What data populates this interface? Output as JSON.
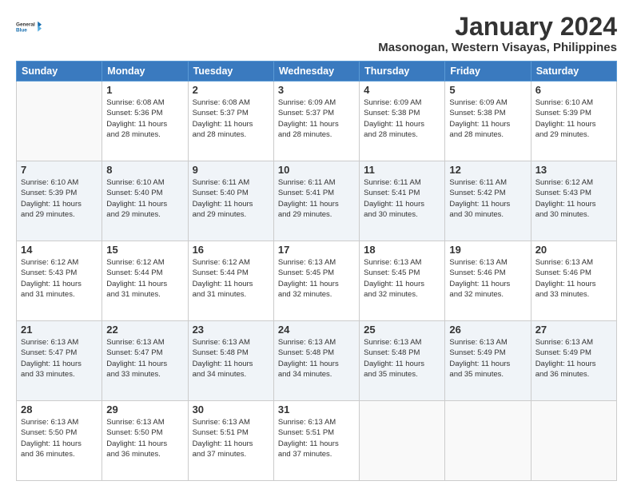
{
  "header": {
    "logo_line1": "General",
    "logo_line2": "Blue",
    "title": "January 2024",
    "subtitle": "Masonogan, Western Visayas, Philippines"
  },
  "days_of_week": [
    "Sunday",
    "Monday",
    "Tuesday",
    "Wednesday",
    "Thursday",
    "Friday",
    "Saturday"
  ],
  "weeks": [
    [
      {
        "day": "",
        "info": ""
      },
      {
        "day": "1",
        "info": "Sunrise: 6:08 AM\nSunset: 5:36 PM\nDaylight: 11 hours\nand 28 minutes."
      },
      {
        "day": "2",
        "info": "Sunrise: 6:08 AM\nSunset: 5:37 PM\nDaylight: 11 hours\nand 28 minutes."
      },
      {
        "day": "3",
        "info": "Sunrise: 6:09 AM\nSunset: 5:37 PM\nDaylight: 11 hours\nand 28 minutes."
      },
      {
        "day": "4",
        "info": "Sunrise: 6:09 AM\nSunset: 5:38 PM\nDaylight: 11 hours\nand 28 minutes."
      },
      {
        "day": "5",
        "info": "Sunrise: 6:09 AM\nSunset: 5:38 PM\nDaylight: 11 hours\nand 28 minutes."
      },
      {
        "day": "6",
        "info": "Sunrise: 6:10 AM\nSunset: 5:39 PM\nDaylight: 11 hours\nand 29 minutes."
      }
    ],
    [
      {
        "day": "7",
        "info": "Sunrise: 6:10 AM\nSunset: 5:39 PM\nDaylight: 11 hours\nand 29 minutes."
      },
      {
        "day": "8",
        "info": "Sunrise: 6:10 AM\nSunset: 5:40 PM\nDaylight: 11 hours\nand 29 minutes."
      },
      {
        "day": "9",
        "info": "Sunrise: 6:11 AM\nSunset: 5:40 PM\nDaylight: 11 hours\nand 29 minutes."
      },
      {
        "day": "10",
        "info": "Sunrise: 6:11 AM\nSunset: 5:41 PM\nDaylight: 11 hours\nand 29 minutes."
      },
      {
        "day": "11",
        "info": "Sunrise: 6:11 AM\nSunset: 5:41 PM\nDaylight: 11 hours\nand 30 minutes."
      },
      {
        "day": "12",
        "info": "Sunrise: 6:11 AM\nSunset: 5:42 PM\nDaylight: 11 hours\nand 30 minutes."
      },
      {
        "day": "13",
        "info": "Sunrise: 6:12 AM\nSunset: 5:43 PM\nDaylight: 11 hours\nand 30 minutes."
      }
    ],
    [
      {
        "day": "14",
        "info": "Sunrise: 6:12 AM\nSunset: 5:43 PM\nDaylight: 11 hours\nand 31 minutes."
      },
      {
        "day": "15",
        "info": "Sunrise: 6:12 AM\nSunset: 5:44 PM\nDaylight: 11 hours\nand 31 minutes."
      },
      {
        "day": "16",
        "info": "Sunrise: 6:12 AM\nSunset: 5:44 PM\nDaylight: 11 hours\nand 31 minutes."
      },
      {
        "day": "17",
        "info": "Sunrise: 6:13 AM\nSunset: 5:45 PM\nDaylight: 11 hours\nand 32 minutes."
      },
      {
        "day": "18",
        "info": "Sunrise: 6:13 AM\nSunset: 5:45 PM\nDaylight: 11 hours\nand 32 minutes."
      },
      {
        "day": "19",
        "info": "Sunrise: 6:13 AM\nSunset: 5:46 PM\nDaylight: 11 hours\nand 32 minutes."
      },
      {
        "day": "20",
        "info": "Sunrise: 6:13 AM\nSunset: 5:46 PM\nDaylight: 11 hours\nand 33 minutes."
      }
    ],
    [
      {
        "day": "21",
        "info": "Sunrise: 6:13 AM\nSunset: 5:47 PM\nDaylight: 11 hours\nand 33 minutes."
      },
      {
        "day": "22",
        "info": "Sunrise: 6:13 AM\nSunset: 5:47 PM\nDaylight: 11 hours\nand 33 minutes."
      },
      {
        "day": "23",
        "info": "Sunrise: 6:13 AM\nSunset: 5:48 PM\nDaylight: 11 hours\nand 34 minutes."
      },
      {
        "day": "24",
        "info": "Sunrise: 6:13 AM\nSunset: 5:48 PM\nDaylight: 11 hours\nand 34 minutes."
      },
      {
        "day": "25",
        "info": "Sunrise: 6:13 AM\nSunset: 5:48 PM\nDaylight: 11 hours\nand 35 minutes."
      },
      {
        "day": "26",
        "info": "Sunrise: 6:13 AM\nSunset: 5:49 PM\nDaylight: 11 hours\nand 35 minutes."
      },
      {
        "day": "27",
        "info": "Sunrise: 6:13 AM\nSunset: 5:49 PM\nDaylight: 11 hours\nand 36 minutes."
      }
    ],
    [
      {
        "day": "28",
        "info": "Sunrise: 6:13 AM\nSunset: 5:50 PM\nDaylight: 11 hours\nand 36 minutes."
      },
      {
        "day": "29",
        "info": "Sunrise: 6:13 AM\nSunset: 5:50 PM\nDaylight: 11 hours\nand 36 minutes."
      },
      {
        "day": "30",
        "info": "Sunrise: 6:13 AM\nSunset: 5:51 PM\nDaylight: 11 hours\nand 37 minutes."
      },
      {
        "day": "31",
        "info": "Sunrise: 6:13 AM\nSunset: 5:51 PM\nDaylight: 11 hours\nand 37 minutes."
      },
      {
        "day": "",
        "info": ""
      },
      {
        "day": "",
        "info": ""
      },
      {
        "day": "",
        "info": ""
      }
    ]
  ]
}
